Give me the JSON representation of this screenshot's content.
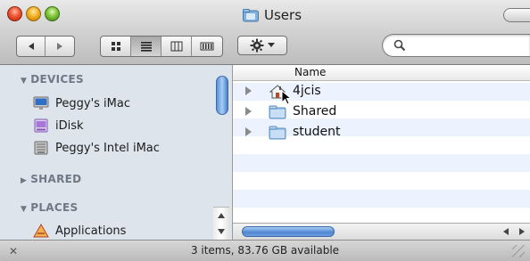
{
  "window": {
    "title": "Users"
  },
  "sidebar": {
    "sections": [
      {
        "label": "DEVICES",
        "state": "expanded"
      },
      {
        "label": "SHARED",
        "state": "collapsed"
      },
      {
        "label": "PLACES",
        "state": "expanded"
      }
    ],
    "items": [
      {
        "label": "Peggy's iMac",
        "icon": "imac-icon"
      },
      {
        "label": "iDisk",
        "icon": "idisk-icon"
      },
      {
        "label": "Peggy's Intel iMac",
        "icon": "hard-drive-icon"
      },
      {
        "label": "Applications",
        "icon": "applications-icon"
      }
    ]
  },
  "list": {
    "column_name": "Name",
    "rows": [
      {
        "label": "4jcis",
        "icon": "home-folder-icon"
      },
      {
        "label": "Shared",
        "icon": "folder-icon"
      },
      {
        "label": "student",
        "icon": "folder-icon"
      }
    ]
  },
  "status": {
    "text": "3 items, 83.76 GB available"
  },
  "colors": {
    "sidebar_bg": "#dde4eb",
    "row_stripe": "#edf3fe",
    "selection_blue": "#4f86d1"
  }
}
